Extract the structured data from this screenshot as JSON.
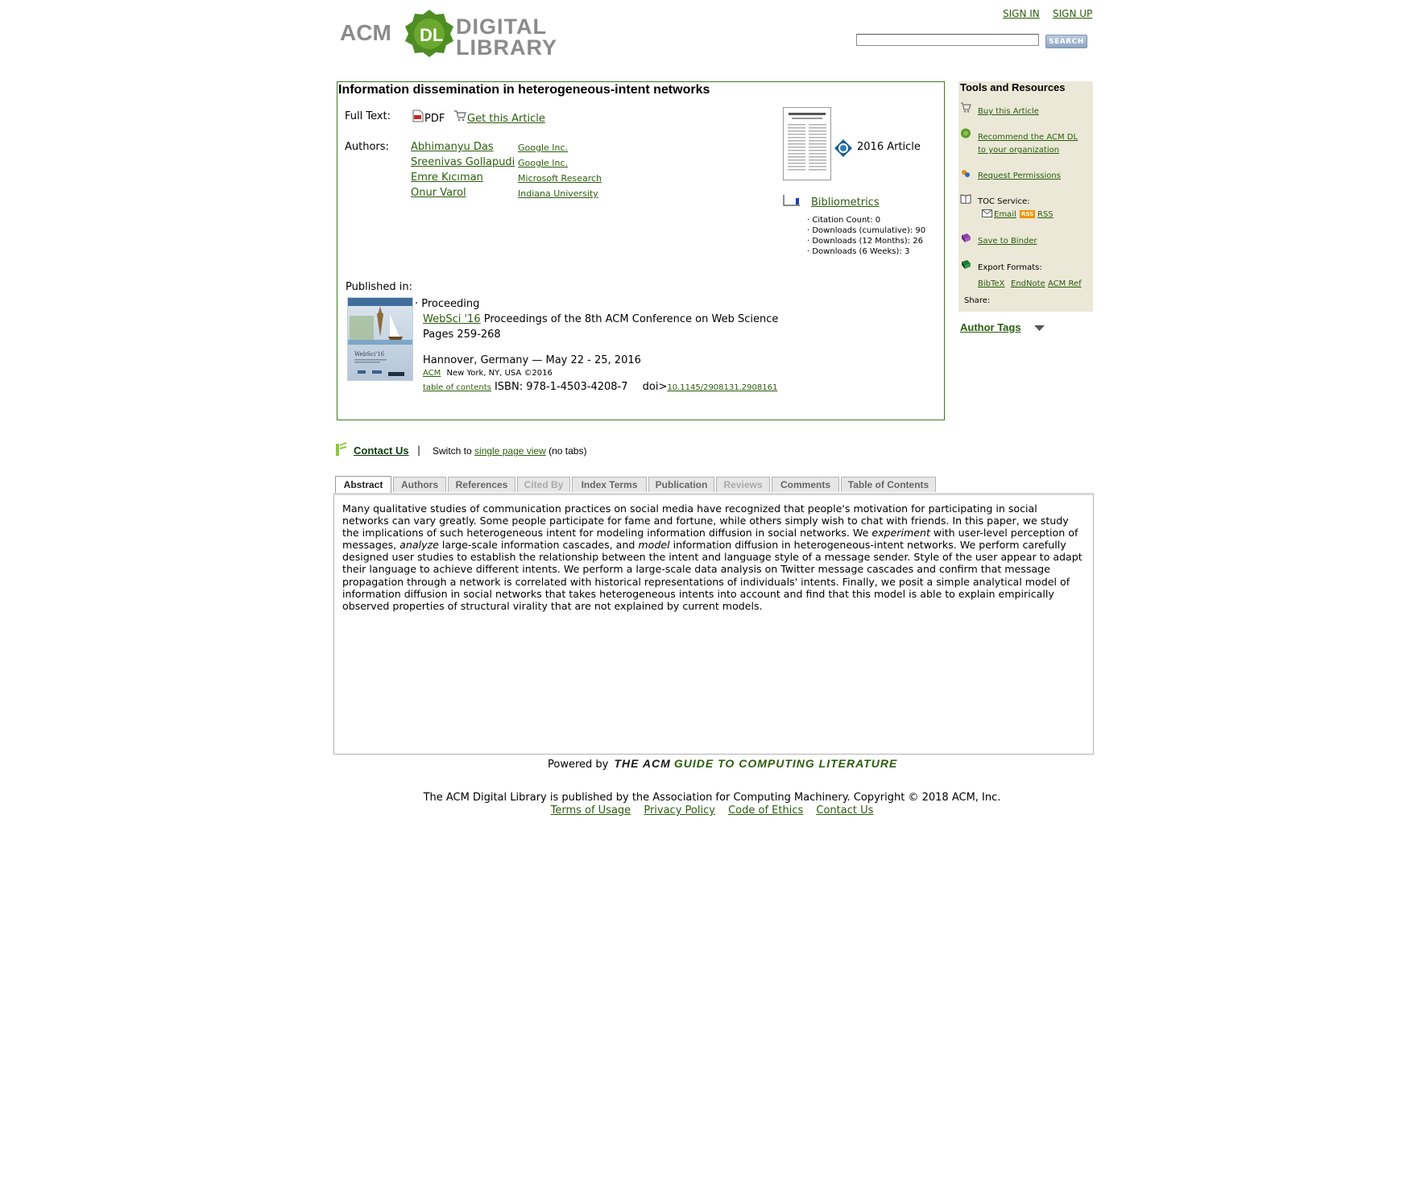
{
  "header": {
    "logo_acm": "ACM",
    "logo_dl": "DL",
    "logo_digital": "DIGITAL",
    "logo_library": "LIBRARY",
    "sign_in": "SIGN IN",
    "sign_up": "SIGN UP",
    "search_value": "",
    "search_button": "SEARCH"
  },
  "article": {
    "title": "Information dissemination in heterogeneous-intent networks",
    "full_text_label": "Full Text:",
    "pdf_label": "PDF",
    "get_article_label": "Get this Article",
    "authors_label": "Authors:",
    "authors": [
      {
        "name": "Abhimanyu Das",
        "affiliation": "Google Inc."
      },
      {
        "name": "Sreenivas Gollapudi",
        "affiliation": "Google Inc."
      },
      {
        "name": "Emre Kıcıman",
        "affiliation": "Microsoft Research"
      },
      {
        "name": "Onur Varol",
        "affiliation": "Indiana University"
      }
    ],
    "article_type": "2016 Article",
    "bibliometrics_label": "Bibliometrics",
    "bibliometrics": [
      "· Citation Count: 0",
      "· Downloads (cumulative): 90",
      "· Downloads (12 Months): 26",
      "· Downloads (6 Weeks): 3"
    ],
    "published_in_label": "Published in:",
    "proc_type": "Proceeding",
    "proc_acronym": "WebSci '16",
    "proc_title": "Proceedings of the 8th ACM Conference on Web Science",
    "pages": "Pages 259-268",
    "location": "Hannover, Germany — May 22 - 25, 2016",
    "publisher": "ACM",
    "publisher_info": "New York, NY, USA ©2016",
    "toc_link": "table of contents",
    "isbn": "ISBN: 978-1-4503-4208-7",
    "doi_prefix": "doi>",
    "doi": "10.1145/2908131.2908161",
    "cover_title": "WebSci'16"
  },
  "sidebar": {
    "heading": "Tools and Resources",
    "buy": "Buy this Article",
    "recommend_1": "Recommend the ACM DL",
    "recommend_2": "to your organization",
    "permissions": "Request Permissions",
    "toc_service": "TOC Service:",
    "email": "Email",
    "rss_badge": "RSS",
    "rss": "RSS",
    "binder": "Save to Binder",
    "export": "Export Formats:",
    "bibtex": "BibTeX",
    "endnote": "EndNote",
    "acmref": "ACM Ref",
    "share": "Share:",
    "author_tags": "Author Tags"
  },
  "contact_bar": {
    "contact": "Contact Us",
    "separator": "|",
    "switch_prefix": "Switch to",
    "single_page": "single page view",
    "switch_suffix": "(no tabs)"
  },
  "tabs": [
    "Abstract",
    "Authors",
    "References",
    "Cited By",
    "Index Terms",
    "Publication",
    "Reviews",
    "Comments",
    "Table of Contents"
  ],
  "abstract": {
    "part1": "Many qualitative studies of communication practices on social media have recognized that people's motivation for participating in social networks can vary greatly. Some people participate for fame and fortune, while others simply wish to chat with friends. In this paper, we study the implications of such heterogeneous intent for modeling information diffusion in social networks. We ",
    "em1": "experiment",
    "part2": " with user-level perception of messages, ",
    "em2": "analyze",
    "part3": " large-scale information cascades, and ",
    "em3": "model",
    "part4": " information diffusion in heterogeneous-intent networks. We perform carefully designed user studies to establish the relationship between the intent and language style of a message sender. Style of the user appear to adapt their language to achieve different intents. We perform a large-scale data analysis on Twitter message cascades and confirm that message propagation through a network is correlated with historical representations of individuals' intents. Finally, we posit a simple analytical model of information diffusion in social networks that takes heterogeneous intents into account and find that this model is able to explain empirically observed properties of structural virality that are not explained by current models."
  },
  "footer": {
    "powered_by": "Powered by",
    "guide_the": "THE ACM",
    "guide_rest": "GUIDE TO COMPUTING LITERATURE",
    "copyright": "The ACM Digital Library is published by the Association for Computing Machinery. Copyright © 2018 ACM, Inc.",
    "links": [
      "Terms of Usage",
      "Privacy Policy",
      "Code of Ethics",
      "Contact Us"
    ]
  }
}
